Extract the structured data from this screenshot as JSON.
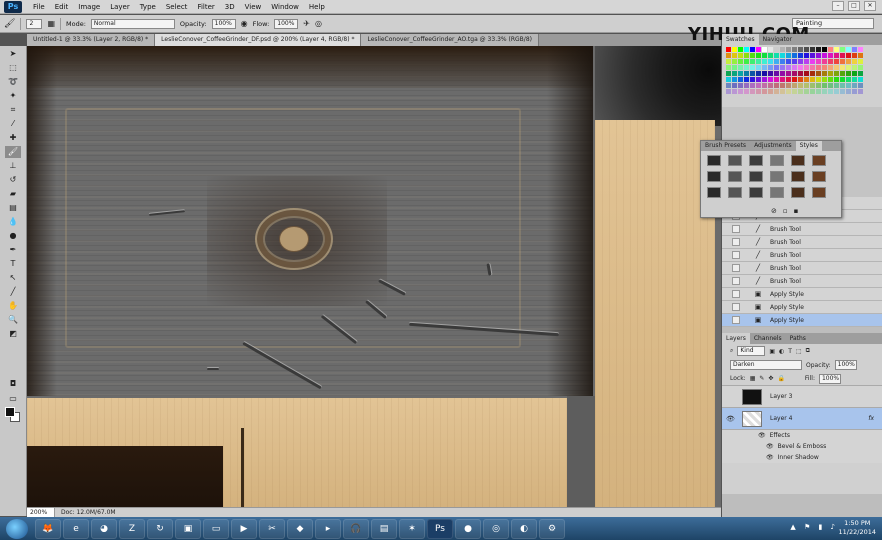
{
  "app": {
    "logo": "Ps"
  },
  "menu": [
    "File",
    "Edit",
    "Image",
    "Layer",
    "Type",
    "Select",
    "Filter",
    "3D",
    "View",
    "Window",
    "Help"
  ],
  "options": {
    "size": "2",
    "mode_label": "Mode:",
    "mode_value": "Normal",
    "opacity_label": "Opacity:",
    "opacity_value": "100%",
    "flow_label": "Flow:",
    "flow_value": "100%",
    "workspace": "Painting"
  },
  "tabs": [
    "Untitled-1 @ 33.3% (Layer 2, RGB/8) *",
    "LeslieConover_CoffeeGrinder_DF.psd @ 200% (Layer 4, RGB/8) *",
    "LeslieConover_CoffeeGrinder_AO.tga @ 33.3% (RGB/8)"
  ],
  "watermark": "YIHUU.COM",
  "status": {
    "zoom": "200%",
    "doc": "Doc: 12.0M/67.0M"
  },
  "panels": {
    "swatches_tabs": [
      "Swatches",
      "Navigator"
    ],
    "styles_tabs": [
      "Brush Presets",
      "Adjustments",
      "Styles"
    ],
    "history_items": [
      "Brush Tool",
      "Brush Tool",
      "Brush Tool",
      "Brush Tool",
      "Brush Tool",
      "Brush Tool",
      "Brush Tool",
      "Apply Style",
      "Apply Style",
      "Apply Style"
    ],
    "layers_tabs": [
      "Layers",
      "Channels",
      "Paths"
    ],
    "layers_kind": "Kind",
    "blend_mode": "Darken",
    "opacity_label": "Opacity:",
    "opacity_value": "100%",
    "lock_label": "Lock:",
    "fill_label": "Fill:",
    "fill_value": "100%",
    "layers": [
      {
        "name": "Layer 3"
      },
      {
        "name": "Layer 4",
        "fx": "fx"
      }
    ],
    "effects_label": "Effects",
    "effects": [
      "Bevel & Emboss",
      "Inner Shadow"
    ]
  },
  "taskbar": {
    "time": "1:50 PM",
    "date": "11/22/2014"
  },
  "colors": {
    "accent_selection": "#a8c4ec",
    "swatches": [
      "#ff0000",
      "#ffff00",
      "#00ff00",
      "#00ffff",
      "#0000ff",
      "#ff00ff",
      "#ffffff",
      "#e6e6e6",
      "#cccccc",
      "#b3b3b3",
      "#999999",
      "#808080",
      "#666666",
      "#4d4d4d",
      "#333333",
      "#1a1a1a",
      "#000000",
      "#ff8080",
      "#ffff80",
      "#80ff80",
      "#80ffff",
      "#8080ff",
      "#ff80ff"
    ]
  }
}
